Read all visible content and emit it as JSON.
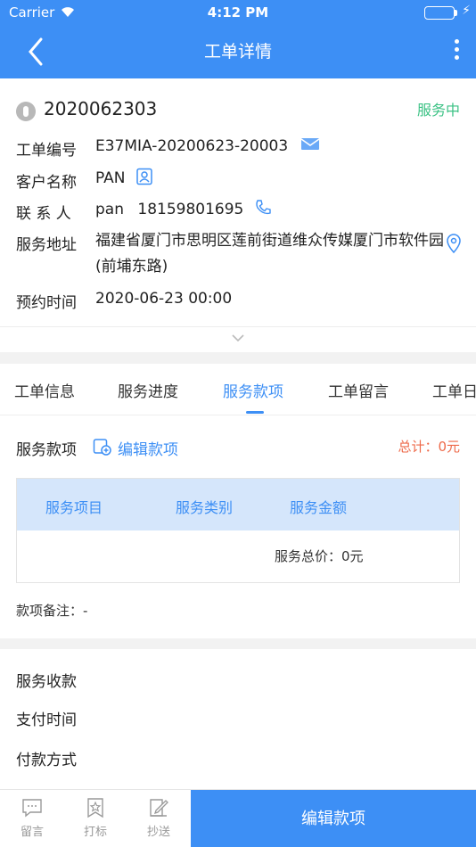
{
  "status_bar": {
    "carrier": "Carrier",
    "time": "4:12 PM"
  },
  "nav": {
    "title": "工单详情"
  },
  "order": {
    "number": "2020062303",
    "status": "服务中",
    "status_color": "#3cc285",
    "fields": {
      "order_code_label": "工单编号",
      "order_code": "E37MIA-20200623-20003",
      "customer_label": "客户名称",
      "customer": "PAN",
      "contact_label": "联 系 人",
      "contact_name": "pan",
      "contact_phone": "18159801695",
      "address_label": "服务地址",
      "address": "福建省厦门市思明区莲前街道维众传媒厦门市软件园(前埔东路)",
      "appointment_label": "预约时间",
      "appointment": "2020-06-23 00:00"
    }
  },
  "tabs": [
    {
      "label": "工单信息"
    },
    {
      "label": "服务进度"
    },
    {
      "label": "服务款项",
      "active": true
    },
    {
      "label": "工单留言"
    },
    {
      "label": "工单日"
    }
  ],
  "fees": {
    "title": "服务款项",
    "edit_label": "编辑款项",
    "total": "总计：0元",
    "table_headers": [
      "服务项目",
      "服务类别",
      "服务金额"
    ],
    "total_price": "服务总价：0元",
    "remark": "款项备注：-"
  },
  "payment": {
    "collect_label": "服务收款",
    "time_label": "支付时间",
    "method_label": "付款方式"
  },
  "bottom_bar": {
    "items": [
      {
        "label": "留言",
        "icon": "message-icon"
      },
      {
        "label": "打标",
        "icon": "star-bookmark-icon"
      },
      {
        "label": "抄送",
        "icon": "cc-edit-icon"
      }
    ],
    "primary_label": "编辑款项"
  },
  "colors": {
    "accent": "#3d8ff5",
    "total": "#ee6a4a",
    "header_bg": "#d5e6fb"
  }
}
